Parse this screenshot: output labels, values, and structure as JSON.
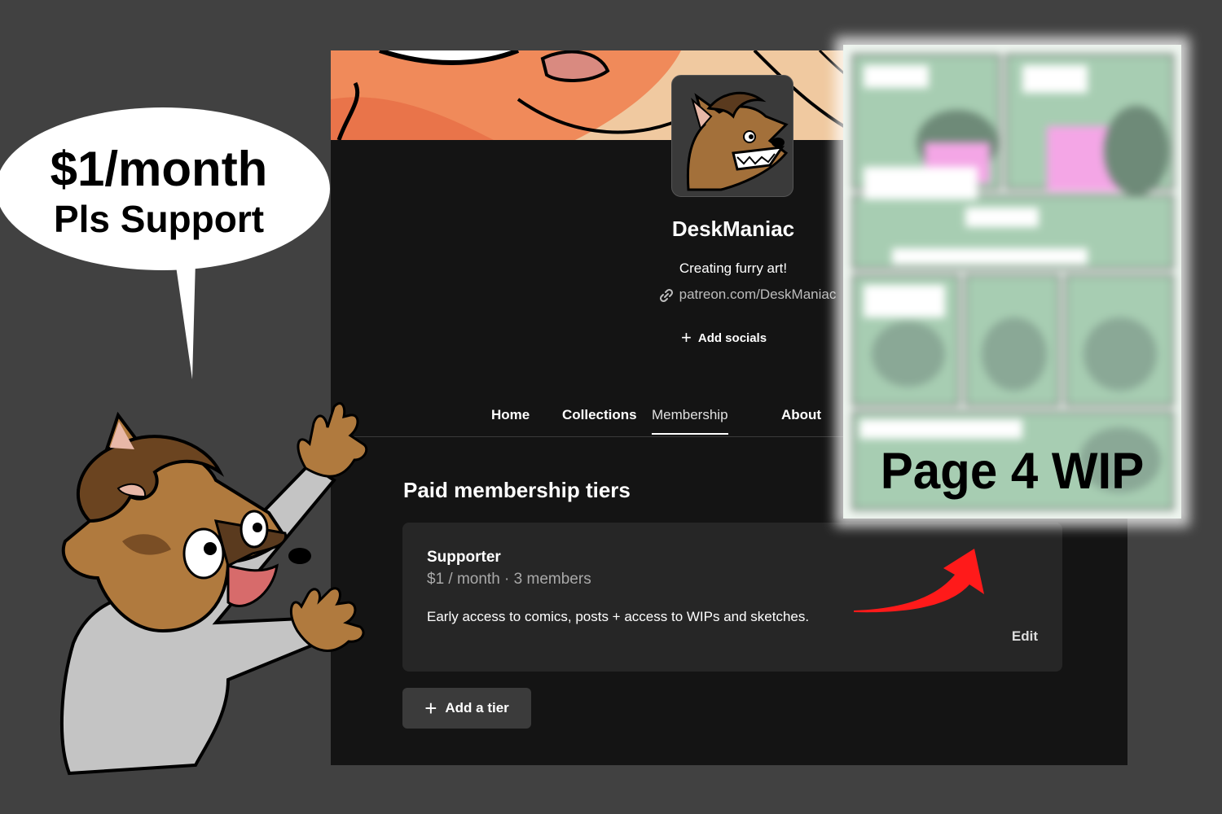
{
  "speech_bubble": {
    "line1": "$1/month",
    "line2": "Pls Support"
  },
  "profile": {
    "name": "DeskManiac",
    "tagline": "Creating furry art!",
    "url": "patreon.com/DeskManiac",
    "add_socials_label": "Add socials"
  },
  "nav": {
    "tabs": [
      {
        "label": "Home"
      },
      {
        "label": "Collections"
      },
      {
        "label": "Membership",
        "active": true
      },
      {
        "label": "About"
      }
    ]
  },
  "membership": {
    "section_title": "Paid membership tiers",
    "tier": {
      "name": "Supporter",
      "meta": "$1 / month · 3 members",
      "description": "Early access to comics, posts + access to WIPs and sketches.",
      "edit_label": "Edit"
    },
    "add_tier_label": "Add a tier"
  },
  "wip_preview": {
    "label": "Page 4 WIP"
  },
  "icons": [
    "link-icon",
    "plus-icon",
    "red-arrow-icon"
  ],
  "colors": {
    "page_background": "#414141",
    "patreon_background": "#141414",
    "card_background": "#262626",
    "arrow": "#ff1a1a",
    "sketch_green": "#a7cdb2"
  }
}
